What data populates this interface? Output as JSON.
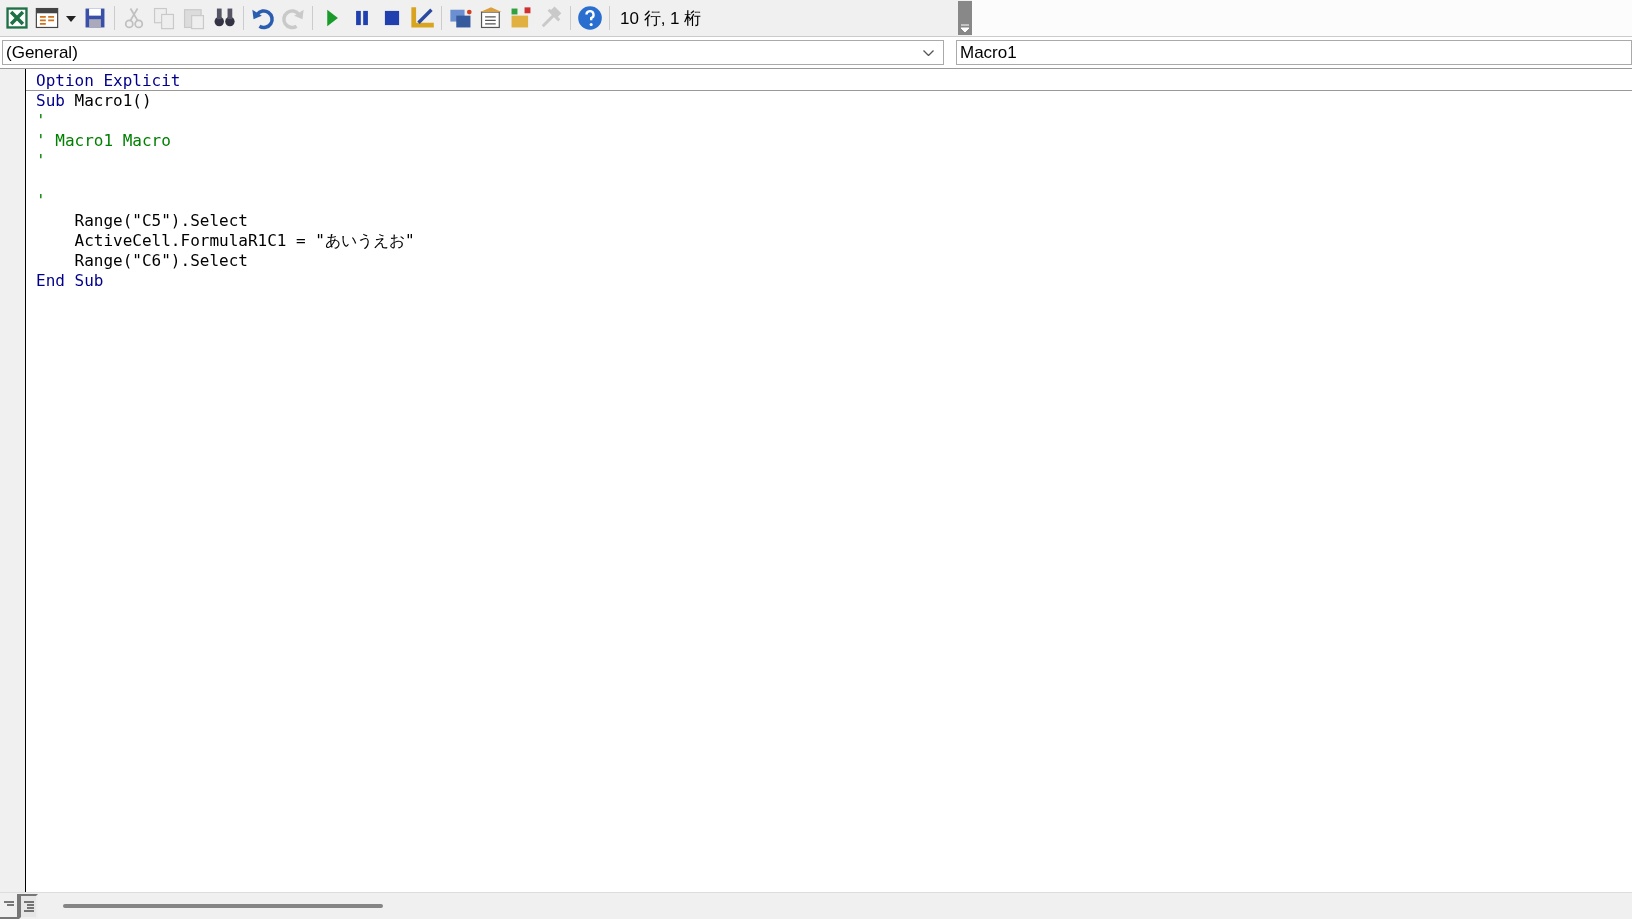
{
  "toolbar": {
    "buttons": [
      {
        "kind": "excel",
        "disabled": false
      },
      {
        "kind": "insert-form",
        "disabled": false
      },
      {
        "kind": "dropdown",
        "disabled": false
      },
      {
        "kind": "save",
        "disabled": false
      },
      {
        "kind": "cut",
        "disabled": true
      },
      {
        "kind": "copy",
        "disabled": true
      },
      {
        "kind": "paste",
        "disabled": true
      },
      {
        "kind": "find",
        "disabled": false
      },
      {
        "kind": "undo",
        "disabled": false
      },
      {
        "kind": "redo",
        "disabled": true
      },
      {
        "kind": "run",
        "disabled": false
      },
      {
        "kind": "pause",
        "disabled": false
      },
      {
        "kind": "stop",
        "disabled": false
      },
      {
        "kind": "design",
        "disabled": false
      },
      {
        "kind": "project",
        "disabled": false
      },
      {
        "kind": "properties",
        "disabled": false
      },
      {
        "kind": "object-browser",
        "disabled": false
      },
      {
        "kind": "toolbox",
        "disabled": true
      },
      {
        "kind": "help",
        "disabled": false
      }
    ],
    "position": "10 行, 1 桁"
  },
  "object_box": {
    "value": "(General)"
  },
  "procedure_box": {
    "value": "Macro1"
  },
  "code": {
    "lines": [
      {
        "segments": [
          {
            "kind": "keyword",
            "text": "Option Explicit"
          }
        ],
        "separator": true
      },
      {
        "segments": [
          {
            "kind": "keyword",
            "text": "Sub"
          },
          {
            "kind": "plain",
            "text": " Macro1()"
          }
        ],
        "separator": false
      },
      {
        "segments": [
          {
            "kind": "comment",
            "text": "'"
          }
        ],
        "separator": false
      },
      {
        "segments": [
          {
            "kind": "comment",
            "text": "' Macro1 Macro"
          }
        ],
        "separator": false
      },
      {
        "segments": [
          {
            "kind": "comment",
            "text": "'"
          }
        ],
        "separator": false
      },
      {
        "separator": false
      },
      {
        "segments": [
          {
            "kind": "comment",
            "text": "'"
          }
        ],
        "separator": false
      },
      {
        "segments": [
          {
            "kind": "plain",
            "text": "    Range(\"C5\").Select"
          }
        ],
        "separator": false
      },
      {
        "segments": [
          {
            "kind": "plain",
            "text": "    ActiveCell.FormulaR1C1 = \"あいうえお\""
          }
        ],
        "separator": false
      },
      {
        "segments": [
          {
            "kind": "plain",
            "text": "    Range(\"C6\").Select"
          }
        ],
        "separator": false
      },
      {
        "segments": [
          {
            "kind": "keyword",
            "text": "End Sub"
          }
        ],
        "separator": false
      }
    ]
  },
  "view_buttons": [
    {
      "kind": "procedure-view",
      "selected": false
    },
    {
      "kind": "module-view",
      "selected": true
    }
  ]
}
